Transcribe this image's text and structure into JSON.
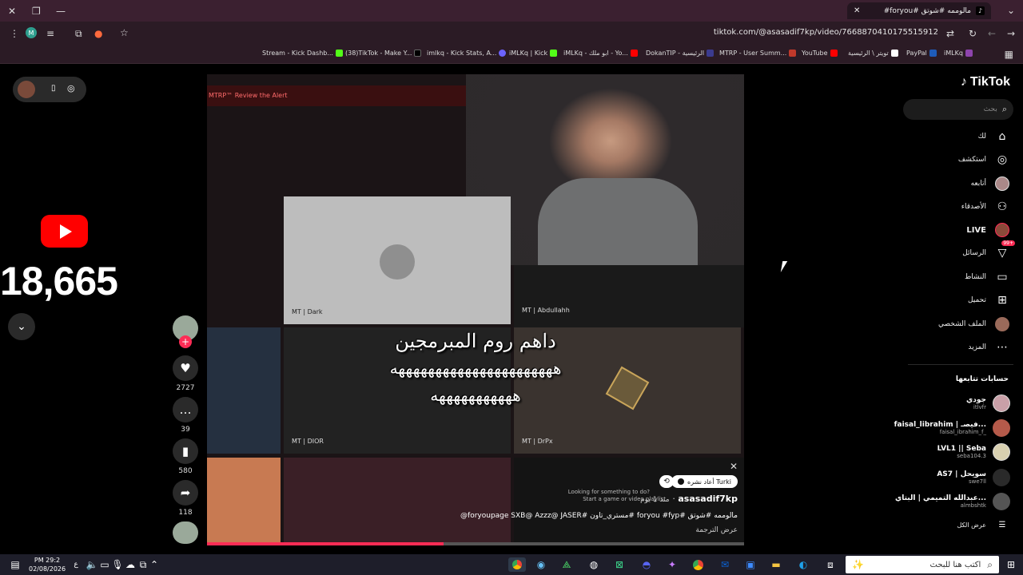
{
  "browser": {
    "tab_title": "مالوممه #شوتق #foryou#",
    "url": "tiktok.com/@asasadif7kp/video/7668870410175515912",
    "profile_initial": "M",
    "bookmarks": [
      "Stream - Kick Dashb...",
      "(38)TikTok - Make Y...",
      "imlkq - Kick Stats, A...",
      "iMLKq | Kick",
      "iMLKq - ابو ملك - Yo...",
      "DokanTIP - الرئيسية",
      "MTRP - User Summ...",
      "YouTube",
      "تويتر \\ الرئيسية",
      "PayPal",
      "iMLKq"
    ]
  },
  "overlay": {
    "subscriber_count": "18,665",
    "youtube_icon": "youtube-logo"
  },
  "video": {
    "tile_top_label": "MTRP™   Review the Alert",
    "tiles": [
      "MT | Dark",
      "MT | Abdullahh",
      "MT | DIOR",
      "MT | DrPx"
    ],
    "caption_line1": "داهم روم المبرمجين",
    "caption_line2": "ههههههههههههههههههههههه",
    "caption_line3": "هههههههههههه",
    "promo_line1": "Looking for something to do?",
    "promo_line2": "Start a game or video playlist",
    "progress": 0.44
  },
  "post": {
    "repost_by": "Turki أعاد نشره",
    "username": "asasadif7kp",
    "time_ago": "منذ 1 يوم",
    "description": "مالوممه #شوتق #foryou #fyp #مستري_تاون #foryoupage SXB@ Azzz@ JASER@",
    "translate": "عرض الترجمة"
  },
  "actions": {
    "likes": "2727",
    "comments": "39",
    "saves": "580",
    "shares": "118"
  },
  "tiktok": {
    "logo": "TikTok",
    "search_placeholder": "بحث",
    "nav": [
      "لك",
      "استكشف",
      "أتابعه",
      "الأصدقاء",
      "LIVE",
      "الرسائل",
      "النشاط",
      "تحميل",
      "الملف الشخصي",
      "المزيد"
    ],
    "messages_badge": "99+",
    "following_title": "حسابات تتابعها",
    "following": [
      {
        "name": "جودي",
        "handle": "itlvfr"
      },
      {
        "name": "faisal_librahim | فيصـ...",
        "handle": "faisal_ibrahim_f_"
      },
      {
        "name": "LVL1 || Seba",
        "handle": "seba104.3"
      },
      {
        "name": "AS7 | سويحل",
        "handle": "swe7ll"
      },
      {
        "name": "عبدالله التميمي | البتاي...",
        "handle": "almbshtk"
      }
    ],
    "see_all": "عرض الكل"
  },
  "taskbar": {
    "search_placeholder": "اكتب هنا للبحث",
    "time": "PM 29:2",
    "date": "02/08/2026",
    "lang": "ع"
  },
  "colors": {
    "accent": "#fe2c55",
    "youtube_red": "#ff0000",
    "chrome_tab": "#3b2030"
  }
}
